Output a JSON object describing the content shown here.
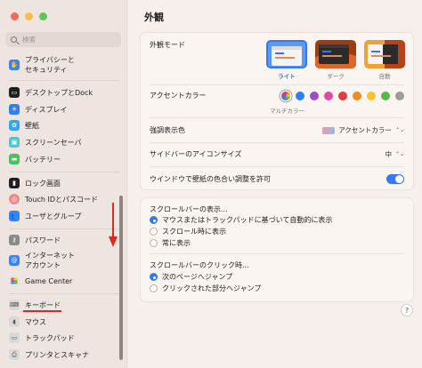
{
  "window": {
    "traffic_colors": [
      "#ee6a5e",
      "#f5be4f",
      "#61c554"
    ]
  },
  "sidebar": {
    "search_placeholder": "検索",
    "items": [
      {
        "label": "プライバシーと",
        "label2": "セキュリティ",
        "icon": "hand-icon",
        "color": "#3b82f6"
      },
      {
        "label": "デスクトップとDock",
        "icon": "desktop-icon",
        "color": "#1f1f1f"
      },
      {
        "label": "ディスプレイ",
        "icon": "sun-icon",
        "color": "#2f7ff2"
      },
      {
        "label": "壁紙",
        "icon": "flower-icon",
        "color": "#35a5f0"
      },
      {
        "label": "スクリーンセーバ",
        "icon": "screensaver-icon",
        "color": "#50c5d6"
      },
      {
        "label": "バッテリー",
        "icon": "battery-icon",
        "color": "#4ac25e"
      },
      {
        "label": "ロック画面",
        "icon": "lock-icon",
        "color": "#1f1f1f"
      },
      {
        "label": "Touch IDとパスコード",
        "icon": "fingerprint-icon",
        "color": "#ef8a8a"
      },
      {
        "label": "ユーザとグループ",
        "icon": "users-icon",
        "color": "#3b82f6"
      },
      {
        "label": "パスワード",
        "icon": "key-icon",
        "color": "#8a8a8a"
      },
      {
        "label": "インターネット",
        "label2": "アカウント",
        "icon": "at-icon",
        "color": "#3b82f6"
      },
      {
        "label": "Game Center",
        "icon": "gamecenter-icon",
        "color": "#ffffff"
      },
      {
        "label": "キーボード",
        "icon": "keyboard-icon",
        "color": "#9a9a9a"
      },
      {
        "label": "マウス",
        "icon": "mouse-icon",
        "color": "#9a9a9a"
      },
      {
        "label": "トラックパッド",
        "icon": "trackpad-icon",
        "color": "#9a9a9a"
      },
      {
        "label": "プリンタとスキャナ",
        "icon": "printer-icon",
        "color": "#9a9a9a"
      }
    ]
  },
  "main": {
    "title": "外観",
    "appearance": {
      "label": "外観モード",
      "options": [
        {
          "caption": "ライト",
          "selected": true
        },
        {
          "caption": "ダーク",
          "selected": false
        },
        {
          "caption": "自動",
          "selected": false
        }
      ]
    },
    "accent": {
      "label": "アクセントカラー",
      "caption": "マルチカラー",
      "colors": [
        "#b05ce0",
        "#2f7ff2",
        "#9b4fc4",
        "#e04aa6",
        "#e23c3c",
        "#f08a23",
        "#f4c42a",
        "#55b947",
        "#9c9c9c"
      ]
    },
    "highlight": {
      "label": "強調表示色",
      "value": "アクセントカラー"
    },
    "sidebar_icon_size": {
      "label": "サイドバーのアイコンサイズ",
      "value": "中"
    },
    "tinting": {
      "label": "ウインドウで壁紙の色合い調整を許可",
      "on": true
    },
    "scrollbars": {
      "label": "スクロールバーの表示...",
      "options": [
        {
          "label": "マウスまたはトラックパッドに基づいて自動的に表示",
          "selected": true
        },
        {
          "label": "スクロール時に表示",
          "selected": false
        },
        {
          "label": "常に表示",
          "selected": false
        }
      ]
    },
    "click": {
      "label": "スクロールバーのクリック時...",
      "options": [
        {
          "label": "次のページへジャンプ",
          "selected": true
        },
        {
          "label": "クリックされた部分へジャンプ",
          "selected": false
        }
      ]
    },
    "help": "?"
  }
}
